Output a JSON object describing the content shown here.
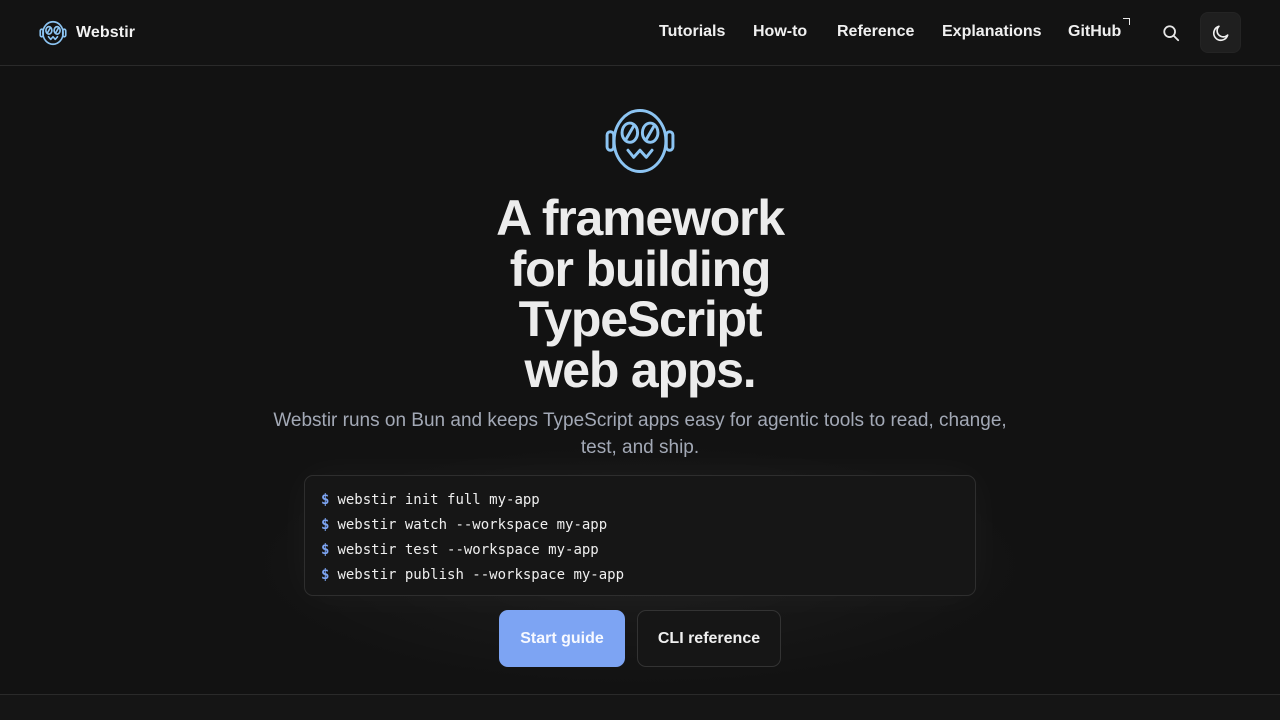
{
  "header": {
    "brand_name": "Webstir",
    "nav": [
      "Tutorials",
      "How-to",
      "Reference",
      "Explanations",
      "GitHub"
    ]
  },
  "icons": {
    "brand": "webstir-logo-icon",
    "search": "search-icon",
    "theme": "moon-icon",
    "external": "external-link-icon"
  },
  "hero": {
    "title_lines": [
      "A framework",
      "for building",
      "TypeScript",
      "web apps."
    ],
    "subtitle": "Webstir runs on Bun and keeps TypeScript apps easy for agentic tools to read, change, test, and ship."
  },
  "terminal": {
    "prompt": "$",
    "commands": [
      "webstir init full my-app",
      "webstir watch --workspace my-app",
      "webstir test --workspace my-app",
      "webstir publish --workspace my-app"
    ]
  },
  "actions": {
    "primary_label": "Start guide",
    "secondary_label": "CLI reference"
  },
  "colors": {
    "background": "#121212",
    "accent": "#7da4f3",
    "logo_stroke": "#8cc4f2"
  }
}
